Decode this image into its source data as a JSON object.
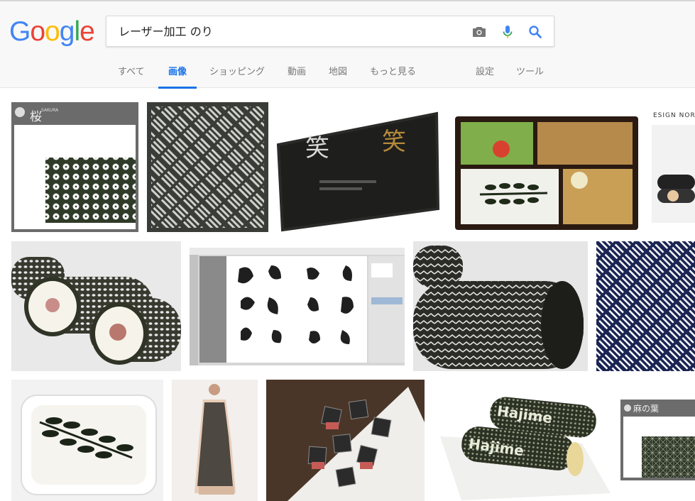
{
  "logo": {
    "text": "Google",
    "letters": [
      {
        "char": "G",
        "color": "#4285F4"
      },
      {
        "char": "o",
        "color": "#EA4335"
      },
      {
        "char": "o",
        "color": "#FBBC05"
      },
      {
        "char": "g",
        "color": "#4285F4"
      },
      {
        "char": "l",
        "color": "#34A853"
      },
      {
        "char": "e",
        "color": "#EA4335"
      }
    ]
  },
  "search": {
    "query": "レーザー加工 のり",
    "camera_icon": "camera-icon",
    "mic_icon": "microphone-icon",
    "search_icon": "search-icon"
  },
  "tabs": {
    "all": "すべて",
    "images": "画像",
    "shopping": "ショッピング",
    "videos": "動画",
    "maps": "地図",
    "more": "もっと見る",
    "settings": "設定",
    "tools": "ツール",
    "active": "画像"
  },
  "colors": {
    "accent": "#1a73e8",
    "tab_text": "#777777",
    "header_bg": "#f8f8f8"
  },
  "thumbnails": {
    "row1": [
      {
        "caption": "SAKURA",
        "title": "桜"
      },
      {
        "caption": ""
      },
      {
        "caption": "",
        "title": "笑"
      },
      {
        "caption": ""
      },
      {
        "caption": "ESIGN NORI"
      }
    ],
    "row2": [
      {
        "caption": ""
      },
      {
        "caption": ""
      },
      {
        "caption": ""
      },
      {
        "caption": ""
      }
    ],
    "row3": [
      {
        "caption": ""
      },
      {
        "caption": ""
      },
      {
        "caption": ""
      },
      {
        "caption": "Hajime"
      },
      {
        "caption": "",
        "title": "麻の葉"
      }
    ]
  }
}
